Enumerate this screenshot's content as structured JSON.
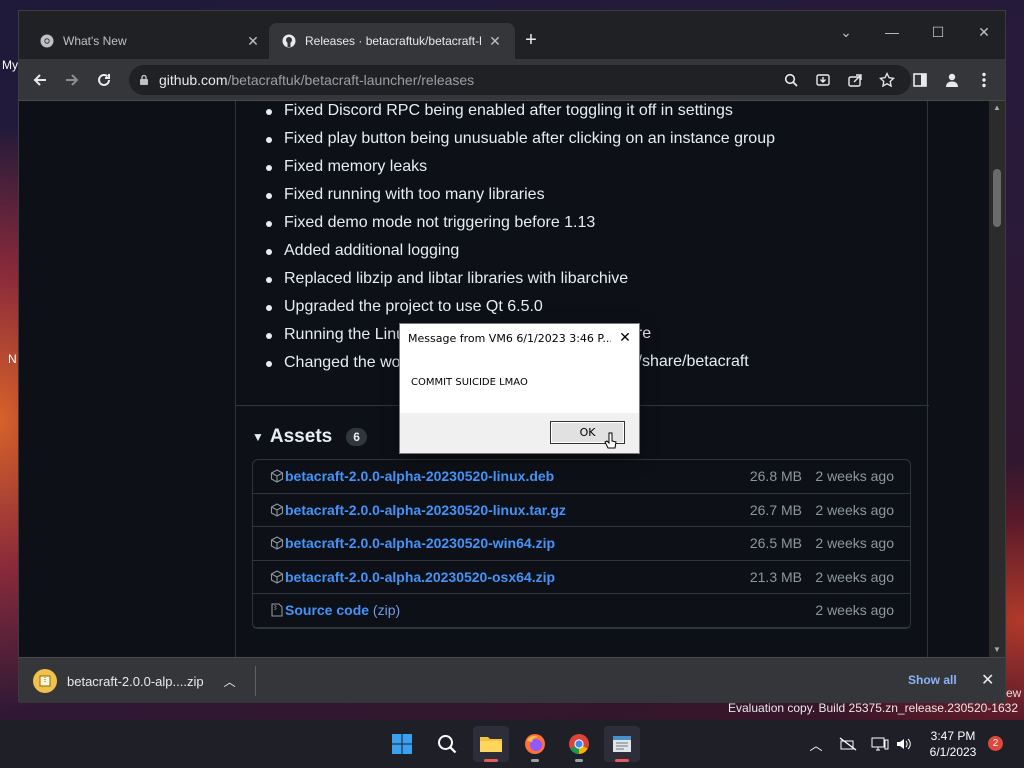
{
  "desktop": {
    "labels": [
      "My",
      "N"
    ],
    "edge_text": "ew",
    "evaluation_text": "Evaluation copy. Build 25375.zn_release.230520-1632"
  },
  "browser": {
    "tabs": [
      {
        "title": "What's New",
        "icon": "chrome-icon",
        "active": false
      },
      {
        "title": "Releases · betacraftuk/betacraft-l",
        "icon": "github-icon",
        "active": true
      }
    ],
    "address": {
      "host": "github.com",
      "path": "/betacraftuk/betacraft-launcher/releases"
    }
  },
  "release_notes": [
    "Fixed Discord RPC being enabled after toggling it off in settings",
    "Fixed play button being unusuable after clicking on an instance group",
    "Fixed memory leaks",
    "Fixed running with too many libraries",
    "Fixed demo mode not triggering before 1.13",
    "Added additional logging",
    "Replaced libzip and libtar libraries with libarchive",
    "Upgraded the project to use Qt 6.5.0",
    "Running the Linu",
    "Changed the wo"
  ],
  "release_notes_hidden_tails": {
    "8": "ore",
    "9": "l/share/betacraft"
  },
  "assets": {
    "title": "Assets",
    "count": "6",
    "items": [
      {
        "name": "betacraft-2.0.0-alpha-20230520-linux.deb",
        "size": "26.8 MB",
        "date": "2 weeks ago"
      },
      {
        "name": "betacraft-2.0.0-alpha-20230520-linux.tar.gz",
        "size": "26.7 MB",
        "date": "2 weeks ago"
      },
      {
        "name": "betacraft-2.0.0-alpha-20230520-win64.zip",
        "size": "26.5 MB",
        "date": "2 weeks ago"
      },
      {
        "name": "betacraft-2.0.0-alpha.20230520-osx64.zip",
        "size": "21.3 MB",
        "date": "2 weeks ago"
      }
    ],
    "source": {
      "name": "Source code",
      "suffix": "(zip)",
      "size": "",
      "date": "2 weeks ago"
    }
  },
  "download_shelf": {
    "file": "betacraft-2.0.0-alp....zip",
    "show_all": "Show all"
  },
  "dialog": {
    "title": "Message from VM6 6/1/2023 3:46 P...",
    "message": "COMMIT SUICIDE LMAO",
    "ok": "OK"
  },
  "taskbar": {
    "time": "3:47 PM",
    "date": "6/1/2023",
    "notifications": "2"
  }
}
